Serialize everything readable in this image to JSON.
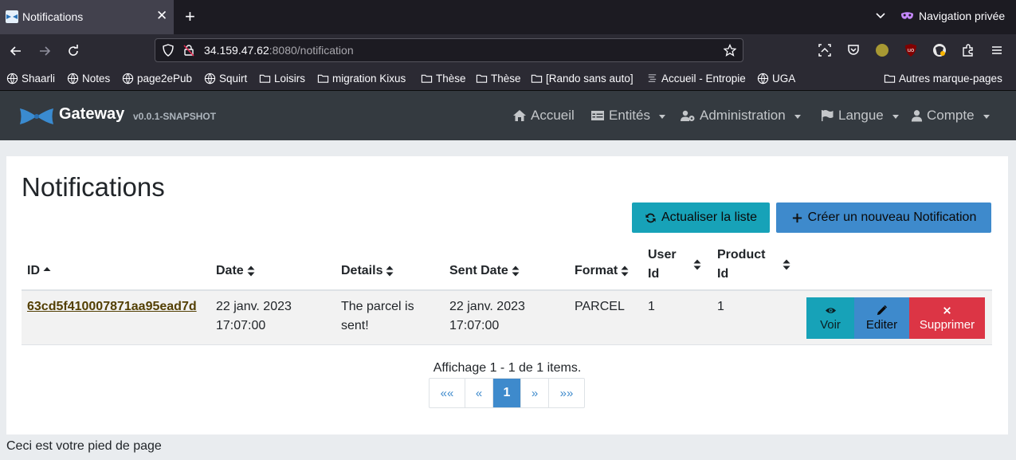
{
  "browser": {
    "tab_title": "Notifications",
    "tab_close": "✕",
    "new_tab": "+",
    "private_label": "Navigation privée",
    "url_host": "34.159.47.62",
    "url_path": ":8080/notification",
    "bookmarks": [
      "Shaarli",
      "Notes",
      "page2ePub",
      "Squirt",
      "Loisirs",
      "migration Kixus",
      "Thèse",
      "Thèse",
      "[Rando sans auto]",
      "Accueil - Entropie",
      "UGA"
    ],
    "other_bookmarks": "Autres marque-pages"
  },
  "app": {
    "brand": "Gateway",
    "version": "v0.0.1-SNAPSHOT",
    "menu": {
      "home": "Accueil",
      "entities": "Entités",
      "admin": "Administration",
      "language": "Langue",
      "account": "Compte"
    }
  },
  "page": {
    "title": "Notifications",
    "refresh_label": "Actualiser la liste",
    "create_label": "Créer un nouveau Notification"
  },
  "table": {
    "headers": {
      "id": "ID",
      "date": "Date",
      "details": "Details",
      "sent_date": "Sent Date",
      "format": "Format",
      "user_id_1": "User",
      "user_id_2": "Id",
      "product_id_1": "Product",
      "product_id_2": "Id"
    },
    "rows": [
      {
        "id": "63cd5f410007871aa95ead7d",
        "date_1": "22 janv. 2023",
        "date_2": "17:07:00",
        "details_1": "The parcel is",
        "details_2": "sent!",
        "sent_date_1": "22 janv. 2023",
        "sent_date_2": "17:07:00",
        "format": "PARCEL",
        "user_id": "1",
        "product_id": "1",
        "actions": {
          "view": "Voir",
          "edit": "Editer",
          "delete": "Supprimer"
        }
      }
    ]
  },
  "pagination": {
    "info": "Affichage 1 - 1 de 1 items.",
    "first": "««",
    "prev": "«",
    "current": "1",
    "next": "»",
    "last": "»»"
  },
  "footer": "Ceci est votre pied de page",
  "colors": {
    "info": "#17a2b8",
    "primary": "#3e8acc",
    "danger": "#dc3545",
    "navbar": "#343a40"
  }
}
